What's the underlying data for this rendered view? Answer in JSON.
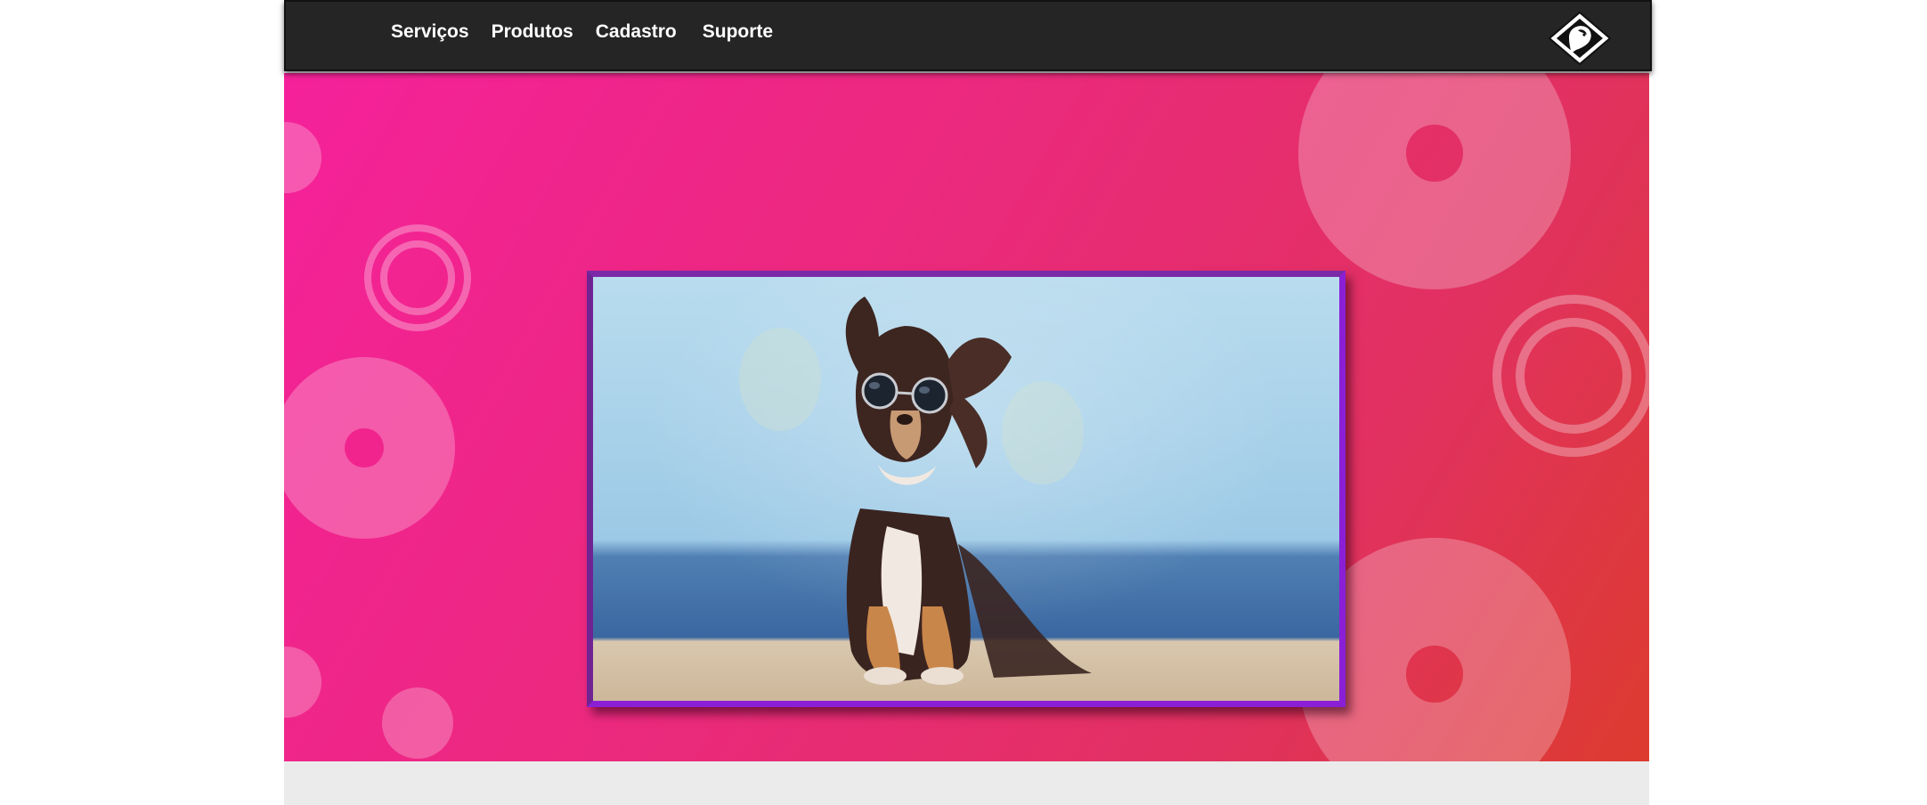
{
  "nav": {
    "links": [
      "Serviços",
      "Produtos",
      "Cadastro",
      "Suporte"
    ]
  },
  "logo": {
    "icon": "dog-head-diamond-icon"
  },
  "hero": {
    "image_subject": "chihuahua-with-sunglasses-photo",
    "colors": {
      "gradient_start": "#f5219a",
      "gradient_end": "#dd3b2f",
      "frame": "#8b1fd6"
    }
  },
  "colors": {
    "navbar": "#252525",
    "footer": "#ebebeb"
  }
}
